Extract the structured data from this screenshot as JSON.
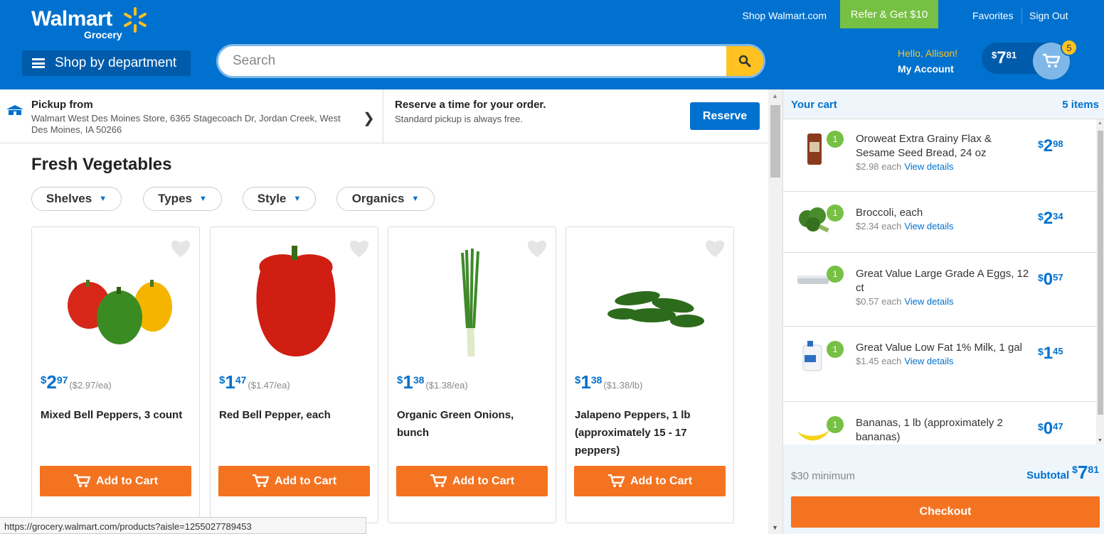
{
  "header": {
    "logo_text": "Walmart",
    "logo_sub": "Grocery",
    "shop_link": "Shop Walmart.com",
    "refer_label": "Refer & Get $10",
    "favorites_label": "Favorites",
    "signout_label": "Sign Out",
    "dept_label": "Shop by department",
    "search_placeholder": "Search",
    "hello_text": "Hello, Allison!",
    "account_label": "My Account",
    "cart_dollar": "$",
    "cart_whole": "7",
    "cart_cents": "81",
    "cart_count": "5",
    "brand_color": "#0071ce",
    "spark_color": "#ffc220"
  },
  "pickup": {
    "title": "Pickup from",
    "address": "Walmart West Des Moines Store, 6365 Stagecoach Dr, Jordan Creek, West Des Moines, IA 50266",
    "reserve_title": "Reserve a time for your order.",
    "reserve_sub": "Standard pickup is always free.",
    "reserve_button": "Reserve"
  },
  "section": {
    "title": "Fresh Vegetables",
    "filters": [
      "Shelves",
      "Types",
      "Style",
      "Organics"
    ]
  },
  "products": [
    {
      "dollar": "$",
      "whole": "2",
      "cents": "97",
      "unit": "($2.97/ea)",
      "name": "Mixed Bell Peppers, 3 count",
      "button": "Add to Cart"
    },
    {
      "dollar": "$",
      "whole": "1",
      "cents": "47",
      "unit": "($1.47/ea)",
      "name": "Red Bell Pepper, each",
      "button": "Add to Cart"
    },
    {
      "dollar": "$",
      "whole": "1",
      "cents": "38",
      "unit": "($1.38/ea)",
      "name": "Organic Green Onions, bunch",
      "button": "Add to Cart"
    },
    {
      "dollar": "$",
      "whole": "1",
      "cents": "38",
      "unit": "($1.38/lb)",
      "name": "Jalapeno Peppers, 1 lb (approximately 15 - 17 peppers)",
      "button": "Add to Cart"
    }
  ],
  "status_url": "https://grocery.walmart.com/products?aisle=1255027789453",
  "cart": {
    "title": "Your cart",
    "count_label": "5 items",
    "items": [
      {
        "qty": "1",
        "name": "Oroweat Extra Grainy Flax & Sesame Seed Bread, 24 oz",
        "each": "$2.98 each",
        "link": "View details",
        "dollar": "$",
        "whole": "2",
        "cents": "98"
      },
      {
        "qty": "1",
        "name": "Broccoli, each",
        "each": "$2.34 each",
        "link": "View details",
        "dollar": "$",
        "whole": "2",
        "cents": "34"
      },
      {
        "qty": "1",
        "name": "Great Value Large Grade A Eggs, 12 ct",
        "each": "$0.57 each",
        "link": "View details",
        "dollar": "$",
        "whole": "0",
        "cents": "57"
      },
      {
        "qty": "1",
        "name": "Great Value Low Fat 1% Milk, 1 gal",
        "each": "$1.45 each",
        "link": "View details",
        "dollar": "$",
        "whole": "1",
        "cents": "45"
      },
      {
        "qty": "1",
        "name": "Bananas, 1 lb (approximately 2 bananas)",
        "each": "",
        "link": "",
        "dollar": "$",
        "whole": "0",
        "cents": "47"
      }
    ],
    "minimum_label": "$30 minimum",
    "subtotal_label": "Subtotal",
    "subtotal_dollar": "$",
    "subtotal_whole": "7",
    "subtotal_cents": "81",
    "checkout_label": "Checkout"
  }
}
